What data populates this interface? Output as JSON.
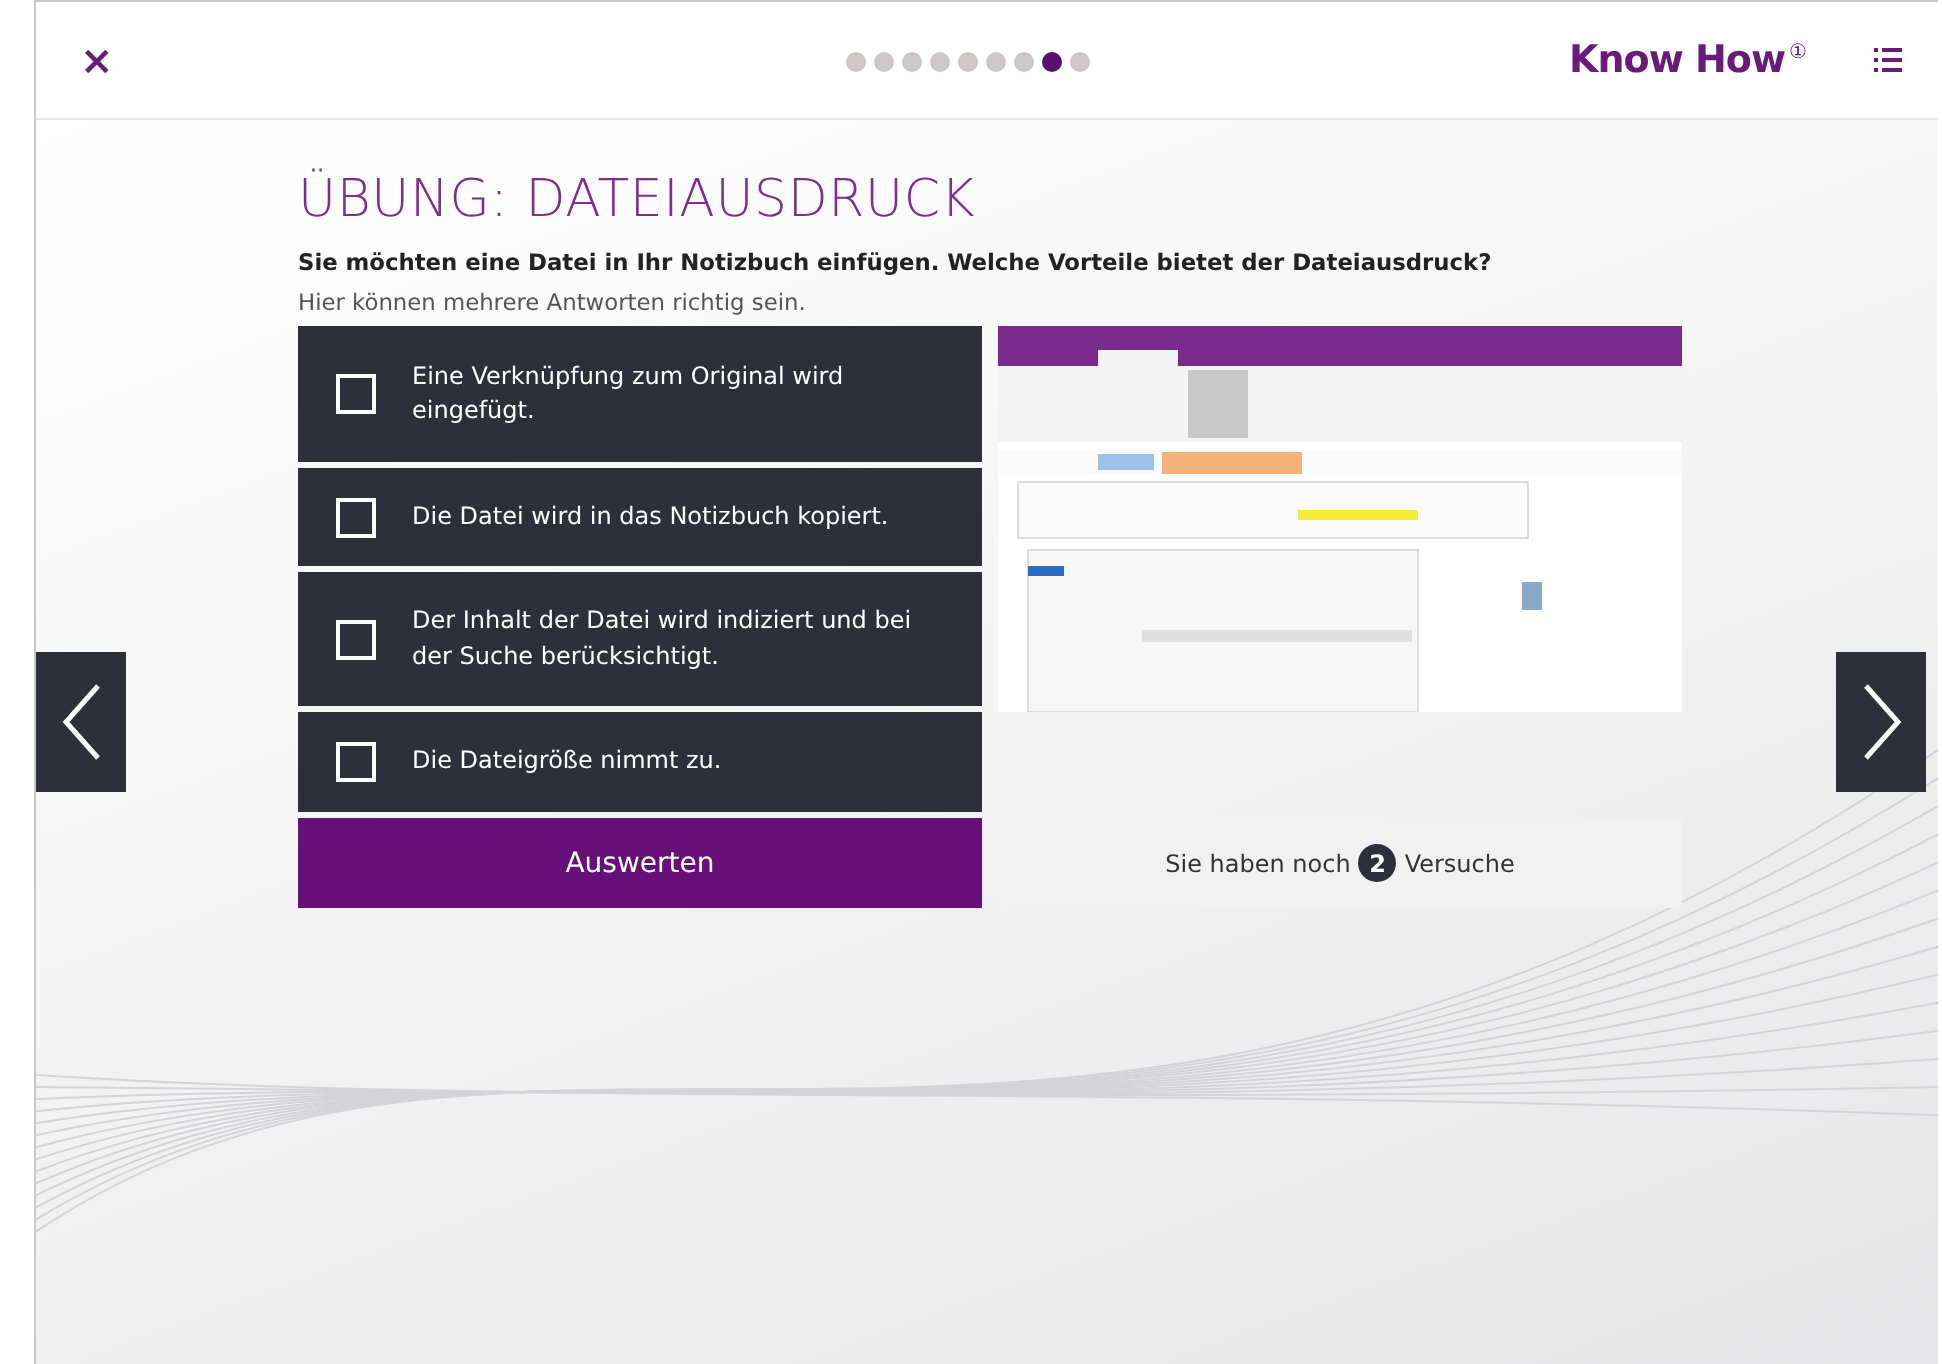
{
  "header": {
    "close": "×",
    "progress": [
      {
        "selected": false
      },
      {
        "selected": false
      },
      {
        "selected": false
      },
      {
        "selected": false
      },
      {
        "selected": false
      },
      {
        "selected": false
      },
      {
        "selected": false
      },
      {
        "selected": true
      },
      {
        "selected": false
      }
    ],
    "logo": "Know How",
    "logo_mark": "①"
  },
  "exercise": {
    "title": "ÜBUNG: DATEIAUSDRUCK",
    "question": "Sie möchten eine Datei in Ihr Notizbuch einfügen. Welche Vorteile bietet der Dateiausdruck?",
    "hint": "Hier können mehrere Antworten richtig sein.",
    "answers": [
      {
        "text": "Eine Verknüpfung zum Original wird eingefügt.",
        "checked": false
      },
      {
        "text": "Die Datei wird in das Notizbuch kopiert.",
        "checked": false
      },
      {
        "text": "Der Inhalt der Datei wird indiziert und bei der Suche berücksichtigt.",
        "checked": false
      },
      {
        "text": "Die Dateigröße nimmt zu.",
        "checked": false
      }
    ],
    "submit": "Auswerten",
    "attempts_before": "Sie haben noch",
    "attempts": "2",
    "attempts_after": "Versuche"
  }
}
